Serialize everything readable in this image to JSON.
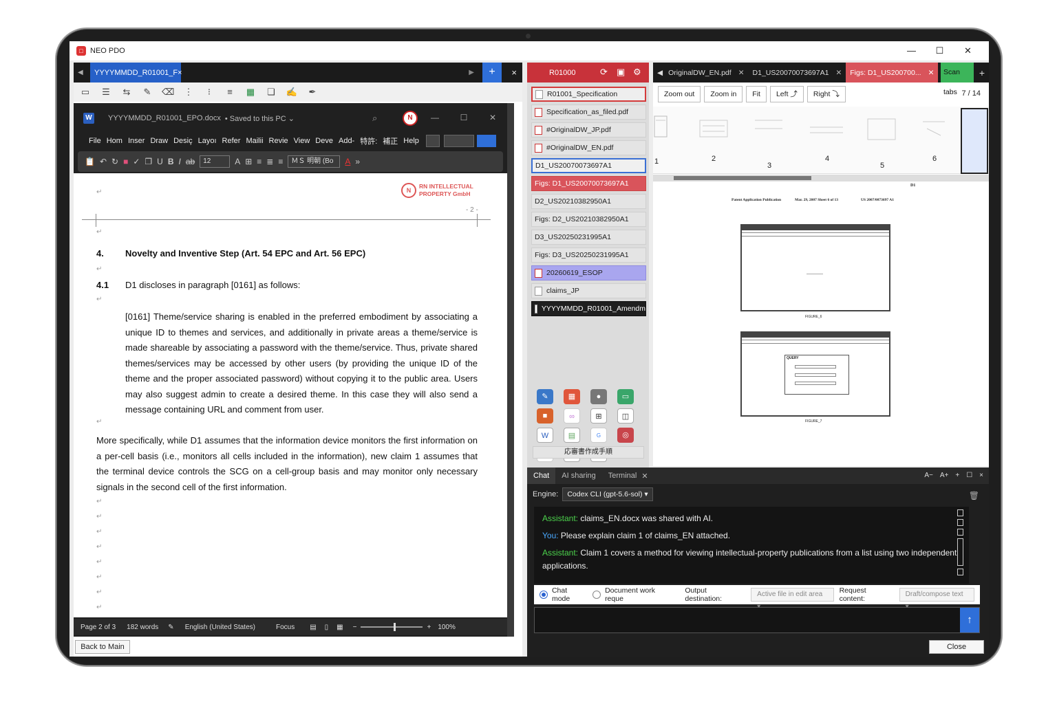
{
  "window": {
    "title": "NEO PDO",
    "minimize": "—",
    "maximize": "☐",
    "close": "✕"
  },
  "doc_tabs": {
    "active": "YYYYMMDD_R01001_F",
    "close": "×",
    "add": "+",
    "close_all": "×"
  },
  "word": {
    "file_title": "YYYYMMDD_R01001_EPO.docx",
    "saved": "• Saved to this PC ⌄",
    "menu": [
      "File",
      "Hom",
      "Inser",
      "Draw",
      "Desiç",
      "Layoı",
      "Refer",
      "Mailii",
      "Revie",
      "View",
      "Deve",
      "Add-",
      "特許:",
      "補正",
      "Help"
    ],
    "font_size": "12",
    "font_name": "ＭＳ 明朝 (Bo",
    "logo_line1": "RN INTELLECTUAL",
    "logo_line2": "PROPERTY GmbH",
    "page_number": "- 2 -",
    "heading_num": "4.",
    "heading": "Novelty and Inventive Step (Art. 54 EPC and Art. 56 EPC)",
    "para41_num": "4.1",
    "para41": "D1 discloses in paragraph [0161] as follows:",
    "quote": "[0161] Theme/service sharing is enabled in the preferred embodiment by associating a unique ID to themes and services, and additionally in private areas a theme/service is made shareable by associating a password with the theme/service. Thus, private shared themes/services may be accessed by other users (by providing the unique ID of the theme and the proper associated password) without copying it to the public area. Users may also suggest admin to create a desired theme. In this case they will also send a message containing URL and comment from user.",
    "body": "More specifically, while D1 assumes that the information device monitors the first information on a per-cell basis (i.e., monitors all cells included in the information), new claim 1 assumes that the terminal device controls the SCG on a cell-group basis and may monitor only necessary signals in the second cell of the first information.",
    "para_mark": "↵",
    "status": {
      "page": "Page 2 of 3",
      "words": "182 words",
      "lang": "English (United States)",
      "focus": "Focus",
      "zoom": "100%"
    }
  },
  "buttons": {
    "back": "Back to Main",
    "close": "Close"
  },
  "middle": {
    "header": "R01000",
    "files": [
      {
        "label": "R01001_Specification",
        "style": "sel-red",
        "icon": "word"
      },
      {
        "label": "Specification_as_filed.pdf",
        "style": "",
        "icon": "pdf"
      },
      {
        "label": "#OriginalDW_JP.pdf",
        "style": "",
        "icon": "pdf"
      },
      {
        "label": "#OriginalDW_EN.pdf",
        "style": "",
        "icon": "pdf"
      },
      {
        "label": "D1_US20070073697A1",
        "style": "sel-blue",
        "icon": ""
      },
      {
        "label": "Figs: D1_US20070073697A1",
        "style": "red",
        "icon": ""
      },
      {
        "label": "D2_US20210382950A1",
        "style": "",
        "icon": ""
      },
      {
        "label": "Figs: D2_US20210382950A1",
        "style": "",
        "icon": ""
      },
      {
        "label": "D3_US20250231995A1",
        "style": "",
        "icon": ""
      },
      {
        "label": "Figs: D3_US20250231995A1",
        "style": "",
        "icon": ""
      },
      {
        "label": "20260619_ESOP",
        "style": "purple",
        "icon": "pdf"
      },
      {
        "label": "claims_JP",
        "style": "",
        "icon": "word"
      },
      {
        "label": "YYYYMMDD_R01001_Amendm",
        "style": "dark",
        "icon": "word"
      }
    ],
    "app_button": "応審書作成手順"
  },
  "pdf": {
    "tabs": [
      "OriginalDW_EN.pdf",
      "D1_US20070073697A1",
      "Figs: D1_US200700..."
    ],
    "scan": "Scan tabs",
    "zoom_out": "Zoom out",
    "zoom_in": "Zoom in",
    "fit": "Fit",
    "left": "Left ⤴",
    "right": "Right ⤵",
    "page_count": "7 / 14",
    "thumb_numbers": [
      "1",
      "2",
      "3",
      "4",
      "5",
      "6"
    ],
    "doc_label": "D1",
    "header_left": "Patent Application Publication",
    "header_mid": "Mar. 29, 2007  Sheet 6 of 13",
    "header_right": "US 2007/0073697 A1",
    "fig6": "FIGURE_6",
    "fig7": "FIGURE_7",
    "query": "QUERY"
  },
  "chat": {
    "tabs": [
      "Chat",
      "AI sharing",
      "Terminal"
    ],
    "tab_close": "✕",
    "tools": [
      "A−",
      "A+",
      "+",
      "☐",
      "×"
    ],
    "engine_label": "Engine:",
    "engine_value": "Codex CLI (gpt-5.6-sol)  ▾",
    "messages": [
      {
        "role": "Assistant:",
        "text": " claims_EN.docx was shared with AI."
      },
      {
        "role": "You:",
        "text": " Please explain claim 1 of claims_EN attached."
      },
      {
        "role": "Assistant:",
        "text": " Claim 1 covers a method for viewing intellectual-property publications from a list using two independent applications."
      }
    ],
    "chat_mode": "Chat mode",
    "doc_work": "Document work reque",
    "output_label": "Output destination:",
    "output_value": "Active file in edit area  ▾",
    "request_label": "Request content:",
    "request_value": "Draft/compose text  ▾",
    "send": "↑"
  }
}
